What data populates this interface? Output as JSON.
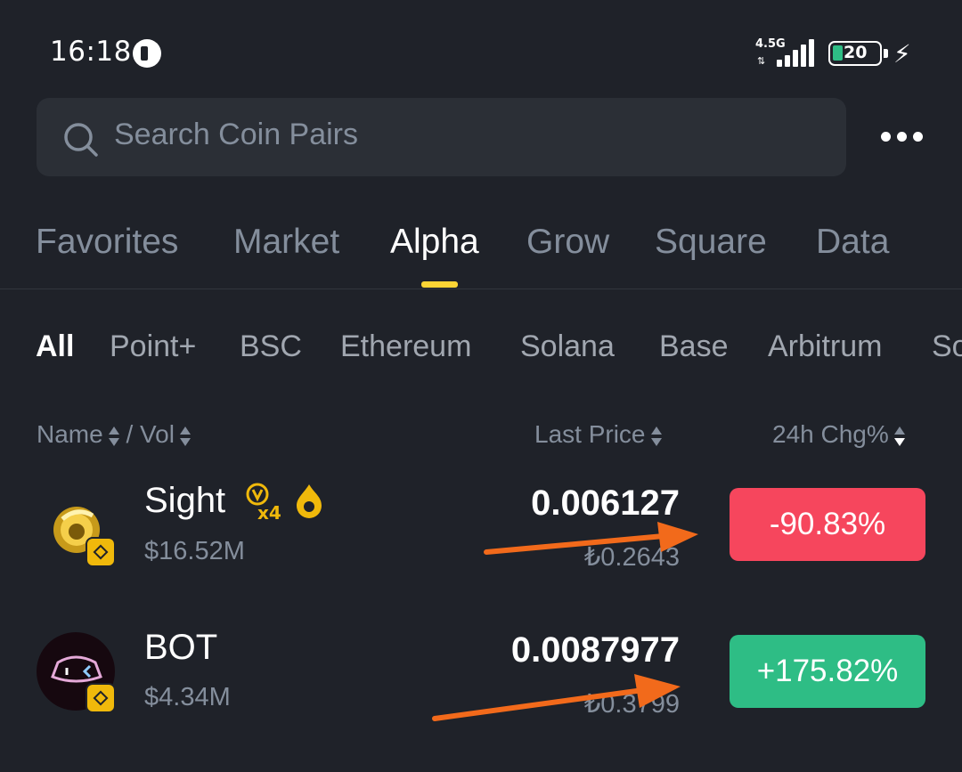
{
  "status_bar": {
    "time": "16:18",
    "network": "4.5G",
    "battery": "20"
  },
  "search": {
    "placeholder": "Search Coin Pairs"
  },
  "main_tabs": [
    {
      "label": "Favorites"
    },
    {
      "label": "Market"
    },
    {
      "label": "Alpha"
    },
    {
      "label": "Grow"
    },
    {
      "label": "Square"
    },
    {
      "label": "Data"
    }
  ],
  "chains": [
    {
      "label": "All"
    },
    {
      "label": "Point+"
    },
    {
      "label": "BSC"
    },
    {
      "label": "Ethereum"
    },
    {
      "label": "Solana"
    },
    {
      "label": "Base"
    },
    {
      "label": "Arbitrum"
    },
    {
      "label": "So"
    }
  ],
  "list_header": {
    "name": "Name",
    "vol": "/ Vol",
    "last_price": "Last Price",
    "change": "24h Chg%"
  },
  "rows": [
    {
      "name": "Sight",
      "multiplier": "x4",
      "volume": "$16.52M",
      "price": "0.006127",
      "local_price": "₺0.2643",
      "change": "-90.83%",
      "change_color": "#f6465d"
    },
    {
      "name": "BOT",
      "volume": "$4.34M",
      "price": "0.0087977",
      "local_price": "₺0.3799",
      "change": "+175.82%",
      "change_color": "#2ebd85"
    }
  ],
  "colors": {
    "accent": "#fcd535",
    "arrow": "#f26a1b",
    "background": "#1f2229"
  }
}
